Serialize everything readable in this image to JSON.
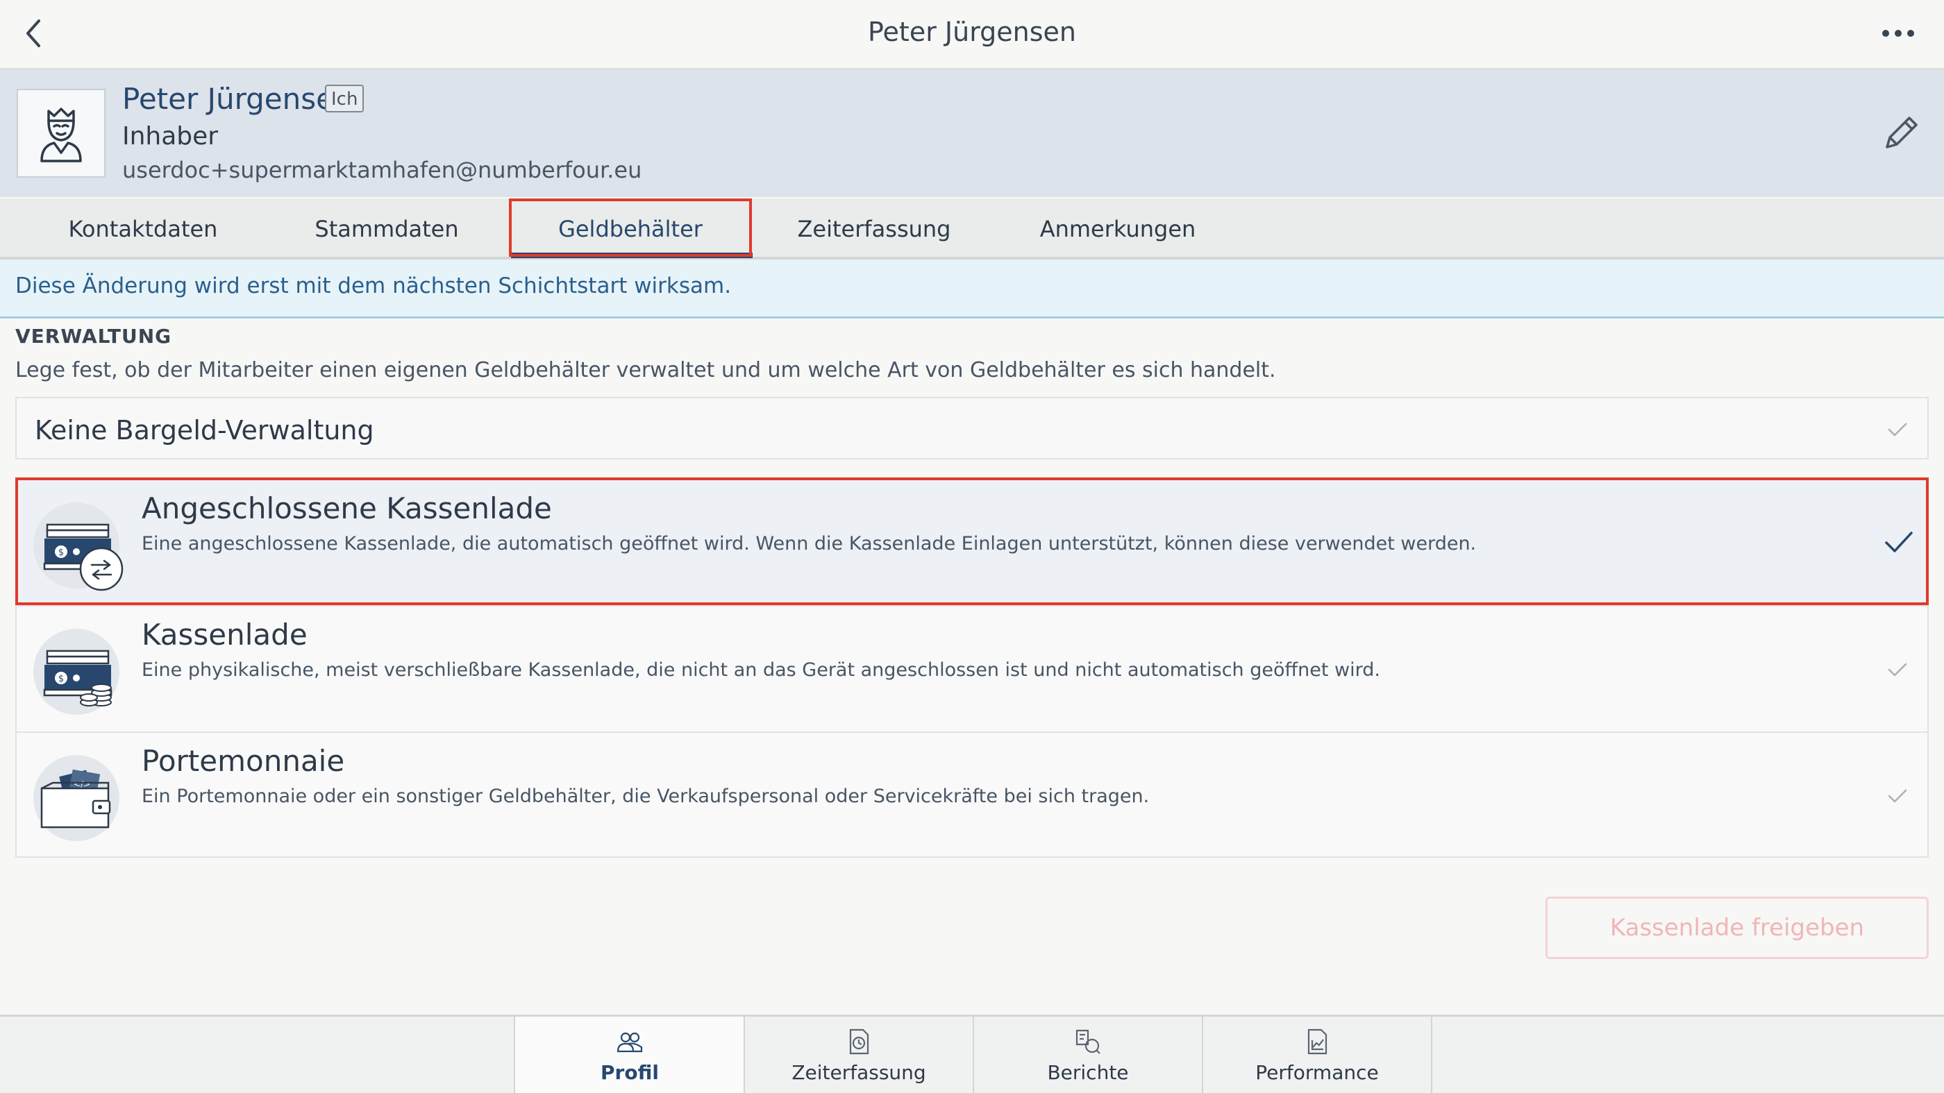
{
  "nav": {
    "title": "Peter Jürgensen",
    "back_icon": "chevron-left-icon",
    "more_icon": "more-dots-icon"
  },
  "profile": {
    "name": "Peter Jürgensen",
    "badge": "Ich",
    "role": "Inhaber",
    "email": "userdoc+supermarktamhafen@numberfour.eu",
    "avatar_icon": "user-avatar-icon",
    "edit_icon": "pencil-icon"
  },
  "tabs": [
    {
      "label": "Kontaktdaten"
    },
    {
      "label": "Stammdaten"
    },
    {
      "label": "Geldbehälter",
      "active": true
    },
    {
      "label": "Zeiterfassung"
    },
    {
      "label": "Anmerkungen"
    }
  ],
  "info": {
    "text": "Diese Änderung wird erst mit dem nächsten Schichtstart wirksam."
  },
  "section": {
    "title": "VERWALTUNG",
    "description": "Lege fest, ob der Mitarbeiter einen eigenen Geldbehälter verwaltet und um welche Art von Geldbehälter es sich handelt."
  },
  "options": {
    "none": {
      "label": "Keine Bargeld-Verwaltung",
      "selected": false
    },
    "items": [
      {
        "title": "Angeschlossene Kassenlade",
        "description": "Eine angeschlossene Kassenlade, die automatisch geöffnet wird. Wenn die Kassenlade Einlagen unterstützt, können diese verwendet werden.",
        "icon": "connected-cash-drawer-icon",
        "selected": true
      },
      {
        "title": "Kassenlade",
        "description": "Eine physikalische, meist verschließbare Kassenlade, die nicht an das Gerät angeschlossen ist und nicht automatisch geöffnet wird.",
        "icon": "cash-drawer-icon",
        "selected": false
      },
      {
        "title": "Portemonnaie",
        "description": "Ein Portemonnaie oder ein sonstiger Geldbehälter, die Verkaufspersonal oder Servicekräfte bei sich tragen.",
        "icon": "wallet-icon",
        "selected": false
      }
    ]
  },
  "release_button": {
    "label": "Kassenlade freigeben",
    "enabled": false
  },
  "bottom_tabs": [
    {
      "label": "Profil",
      "icon": "people-icon",
      "active": true
    },
    {
      "label": "Zeiterfassung",
      "icon": "clock-document-icon",
      "active": false
    },
    {
      "label": "Berichte",
      "icon": "reports-icon",
      "active": false
    },
    {
      "label": "Performance",
      "icon": "chart-document-icon",
      "active": false
    }
  ],
  "colors": {
    "accent": "#27476e",
    "highlight": "#e03a2c",
    "info_bg": "#e6f3f9",
    "header_bg": "#dde3ea"
  }
}
